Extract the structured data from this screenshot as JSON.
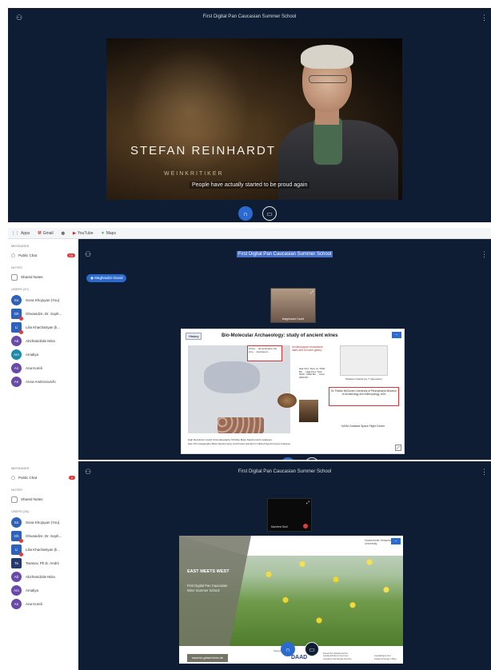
{
  "panel1": {
    "title": "First Digital Pan Caucasian Summer School",
    "video": {
      "name": "STEFAN REINHARDT",
      "role": "WEINKRITIKER",
      "caption": "People have actually started to be proud again"
    }
  },
  "browser": {
    "bookmarks": [
      {
        "icon": "apps-icon",
        "label": "Apps"
      },
      {
        "icon": "gmail-icon",
        "label": "Gmail"
      },
      {
        "icon": "globe-icon",
        "label": ""
      },
      {
        "icon": "youtube-icon",
        "label": "YouTube"
      },
      {
        "icon": "maps-icon",
        "label": "Maps"
      }
    ]
  },
  "panel2": {
    "title": "First Digital Pan Caucasian Summer School",
    "presenter_pill": "Maghradze David",
    "cam_label": "Maghradze David",
    "sidebar": {
      "messages_header": "MESSAGES",
      "public_chat": "Public Chat",
      "chat_badge": "18",
      "notes_header": "NOTES",
      "shared_notes": "Shared Notes",
      "users_header": "USERS (47)",
      "users": [
        {
          "initials": "So",
          "name": "Sona Khojoyan (You)"
        },
        {
          "initials": "Gh",
          "name": "Ghvanidze, Dr. Soph..."
        },
        {
          "initials": "Li",
          "name": "Lilia Khachatryan (li..."
        },
        {
          "initials": "Ab",
          "name": "Abzhanidzde Mzia"
        },
        {
          "initials": "Am",
          "name": "Amaliya"
        },
        {
          "initials": "An",
          "name": "Ana Koreli"
        },
        {
          "initials": "An",
          "name": "Anna Andronovichi"
        }
      ]
    },
    "slide": {
      "tag": "History",
      "title": "Bio-Molecular Archaeology: study of ancient wines",
      "box1": "Africa ... domestication the vine ... developed ...",
      "red_note": "Archaeological excavations dates and red wine gallery",
      "rtags": "Haji Firuz Tepe ca. 5400 BC ... Hajji Firuz Tepe 5400 - 5000 BC ... Areni 4000 BC",
      "pot_caption": "Shulaveri sherds (by T. Ngoushev)",
      "mcgovern": "Dr. Patrick McGovern University of Pennsylvania Museum of Archaeology and Anthropology, USA",
      "nasa": "NASA Goddard Space Flight Center",
      "foot1": "High Resolution Liquid Chromatography Orbitrap Mass Spectrometric analyses",
      "foot2": "Gas Chromatography-Mass Spectrometry and Fourier-transform Infrared Spectrometry Analyses"
    }
  },
  "panel3": {
    "title": "First Digital Pan Caucasian Summer School",
    "cam_label": "Manfred Stoll",
    "sidebar": {
      "messages_header": "MESSAGES",
      "public_chat": "Public Chat",
      "chat_badge": "2",
      "notes_header": "NOTES",
      "shared_notes": "Shared Notes",
      "users_header": "USERS (36)",
      "users": [
        {
          "initials": "So",
          "name": "Sona Khojoyan (You)"
        },
        {
          "initials": "Gh",
          "name": "Ghvanidze, Dr. Soph..."
        },
        {
          "initials": "Li",
          "name": "Lilia Khachatryan (li..."
        },
        {
          "initials": "Ta",
          "name": "Tarasov, Ph.D. Andrii"
        },
        {
          "initials": "Ab",
          "name": "Abzhanidzde Mzia"
        },
        {
          "initials": "Am",
          "name": "Amaliya"
        },
        {
          "initials": "An",
          "name": "Ana Koreli"
        }
      ]
    },
    "slide": {
      "headline": "EAST MEETS WEST",
      "subtitle": "First Digital Pan Caucasian Wine Summer School",
      "website": "www.hs-geisenheim.de",
      "supported_by": "Supported by",
      "daad": "DAAD",
      "daad_note": "Deutscher Akademischer Austauschdienst German Academic Exchange Service",
      "mfa_note": "Auswärtiges Amt Federal Foreign Office",
      "logo_text": "Hochschule Geisenheim University"
    }
  }
}
